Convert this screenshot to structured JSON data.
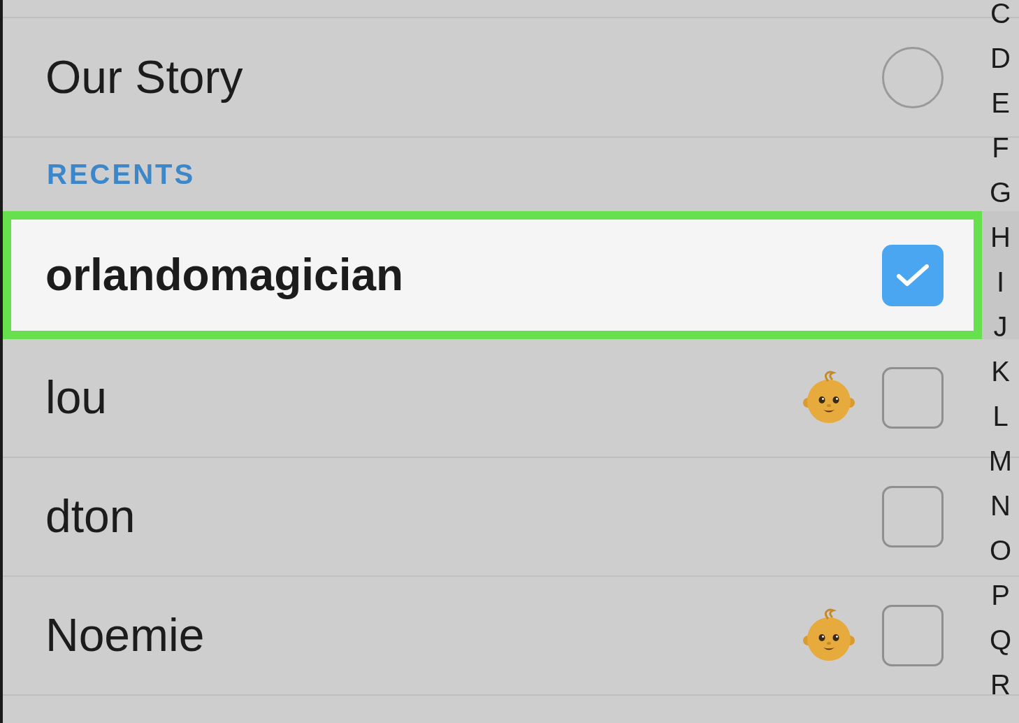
{
  "stories": [
    {
      "name": "Our Story",
      "checked": false
    }
  ],
  "recents": {
    "heading": "RECENTS",
    "friends": [
      {
        "name": "orlandomagician",
        "selected": true,
        "checked": true,
        "emoji_badge": false
      },
      {
        "name": "lou",
        "selected": false,
        "checked": false,
        "emoji_badge": true
      },
      {
        "name": "dton",
        "selected": false,
        "checked": false,
        "emoji_badge": false
      },
      {
        "name": "Noemie",
        "selected": false,
        "checked": false,
        "emoji_badge": true
      }
    ]
  },
  "index_letters": [
    "C",
    "D",
    "E",
    "F",
    "G",
    "H",
    "I",
    "J",
    "K",
    "L",
    "M",
    "N",
    "O",
    "P",
    "Q",
    "R"
  ]
}
